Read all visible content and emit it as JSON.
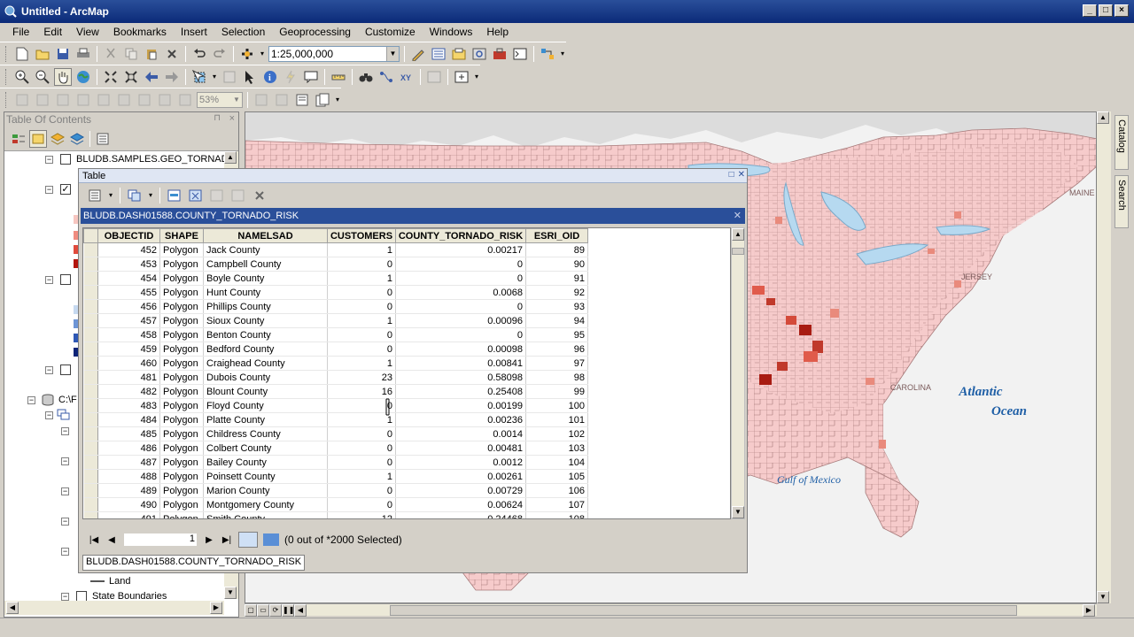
{
  "window": {
    "title": "Untitled - ArcMap"
  },
  "menu": [
    "File",
    "Edit",
    "View",
    "Bookmarks",
    "Insert",
    "Selection",
    "Geoprocessing",
    "Customize",
    "Windows",
    "Help"
  ],
  "toolbar": {
    "scale": "1:25,000,000",
    "zoom_percent": "53%"
  },
  "toc": {
    "title": "Table Of Contents",
    "items": [
      {
        "label": "BLUDB.SAMPLES.GEO_TORNADO",
        "checked": false
      },
      {
        "label": "C:\\F",
        "checked": null
      },
      {
        "label": "Land",
        "checked": null
      },
      {
        "label": "State Boundaries",
        "checked": false
      }
    ]
  },
  "map": {
    "labels": {
      "atlantic": "Atlantic\nOcean",
      "gulf": "Gulf of Mexico",
      "jersey": "JERSEY",
      "carolina": "CAROLINA",
      "maine": "MAINE"
    }
  },
  "right_tabs": {
    "catalog": "Catalog",
    "search": "Search"
  },
  "table_window": {
    "title": "Table",
    "table_name": "BLUDB.DASH01588.COUNTY_TORNADO_RISK",
    "columns": [
      "OBJECTID",
      "SHAPE",
      "NAMELSAD",
      "CUSTOMERS",
      "COUNTY_TORNADO_RISK",
      "ESRI_OID"
    ],
    "rows": [
      [
        "452",
        "Polygon",
        "Jack County",
        "1",
        "0.00217",
        "89"
      ],
      [
        "453",
        "Polygon",
        "Campbell County",
        "0",
        "0",
        "90"
      ],
      [
        "454",
        "Polygon",
        "Boyle County",
        "1",
        "0",
        "91"
      ],
      [
        "455",
        "Polygon",
        "Hunt County",
        "0",
        "0.0068",
        "92"
      ],
      [
        "456",
        "Polygon",
        "Phillips County",
        "0",
        "0",
        "93"
      ],
      [
        "457",
        "Polygon",
        "Sioux County",
        "1",
        "0.00096",
        "94"
      ],
      [
        "458",
        "Polygon",
        "Benton County",
        "0",
        "0",
        "95"
      ],
      [
        "459",
        "Polygon",
        "Bedford County",
        "0",
        "0.00098",
        "96"
      ],
      [
        "460",
        "Polygon",
        "Craighead County",
        "1",
        "0.00841",
        "97"
      ],
      [
        "481",
        "Polygon",
        "Dubois County",
        "23",
        "0.58098",
        "98"
      ],
      [
        "482",
        "Polygon",
        "Blount County",
        "16",
        "0.25408",
        "99"
      ],
      [
        "483",
        "Polygon",
        "Floyd County",
        "0",
        "0.00199",
        "100"
      ],
      [
        "484",
        "Polygon",
        "Platte County",
        "1",
        "0.00236",
        "101"
      ],
      [
        "485",
        "Polygon",
        "Childress County",
        "0",
        "0.0014",
        "102"
      ],
      [
        "486",
        "Polygon",
        "Colbert County",
        "0",
        "0.00481",
        "103"
      ],
      [
        "487",
        "Polygon",
        "Bailey County",
        "0",
        "0.0012",
        "104"
      ],
      [
        "488",
        "Polygon",
        "Poinsett County",
        "1",
        "0.00261",
        "105"
      ],
      [
        "489",
        "Polygon",
        "Marion County",
        "0",
        "0.00729",
        "106"
      ],
      [
        "490",
        "Polygon",
        "Montgomery County",
        "0",
        "0.00624",
        "107"
      ],
      [
        "491",
        "Polygon",
        "Smith County",
        "12",
        "0.24468",
        "108"
      ]
    ],
    "record_number": "1",
    "selection_status": "(0 out of *2000 Selected)",
    "tab_label": "BLUDB.DASH01588.COUNTY_TORNADO_RISK"
  }
}
